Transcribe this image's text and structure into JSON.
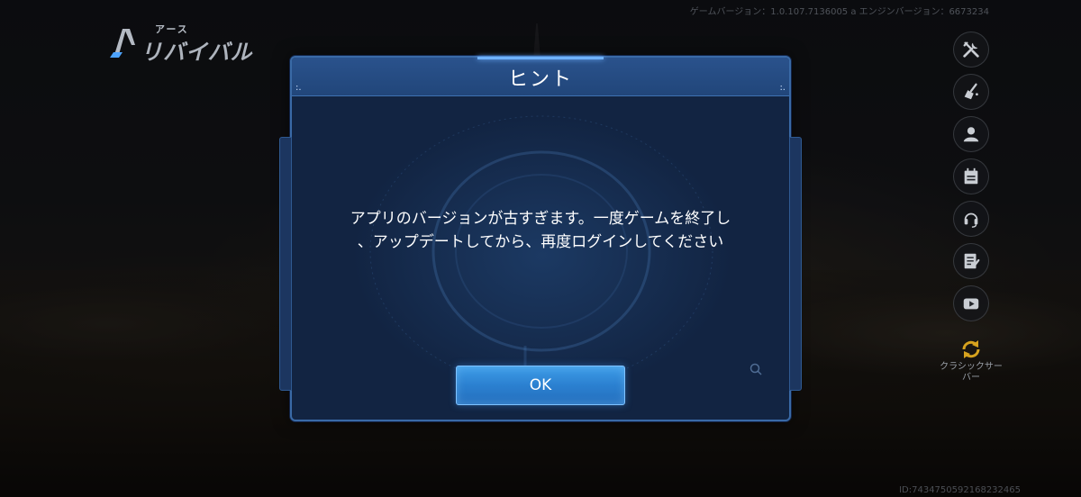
{
  "logo": {
    "small_text": "アース",
    "main_text": "リバイバル"
  },
  "header": {
    "version_text": "ゲームバージョン：1.0.107.7136005 a エンジンバージョン：6673234"
  },
  "footer": {
    "id_text": "ID:7434750592168232465"
  },
  "side_icons": [
    {
      "icon": "tools-icon"
    },
    {
      "icon": "broom-icon"
    },
    {
      "icon": "user-icon"
    },
    {
      "icon": "calendar-icon"
    },
    {
      "icon": "headset-icon"
    },
    {
      "icon": "notes-icon"
    },
    {
      "icon": "play-icon"
    }
  ],
  "classic_server": {
    "label_line1": "クラシックサー",
    "label_line2": "バー"
  },
  "dialog": {
    "title": "ヒント",
    "title_dots": ":.",
    "message_line1": "アプリのバージョンが古すぎます。一度ゲームを終了し",
    "message_line2": "、アップデートしてから、再度ログインしてください",
    "ok_label": "OK"
  },
  "colors": {
    "dialog_bg": "#152a4c",
    "dialog_border": "#3a6aa6",
    "ok_button": "#2b80d0"
  }
}
